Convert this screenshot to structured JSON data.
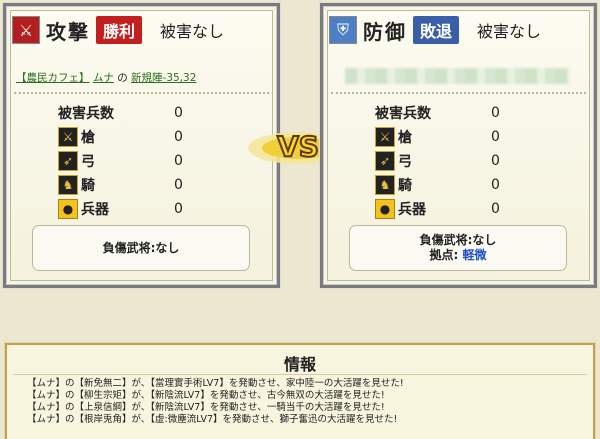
{
  "attacker": {
    "role": "攻撃",
    "result": "勝利",
    "damage": "被害なし",
    "location": {
      "alliance": "【農民カフェ】",
      "player": "ムナ",
      "connector": "の",
      "place": "新規陣-35,32"
    },
    "rows": [
      {
        "label": "被害兵数",
        "value": "0"
      },
      {
        "label": "槍",
        "value": "0",
        "icon": "spear-icon"
      },
      {
        "label": "弓",
        "value": "0",
        "icon": "bow-icon"
      },
      {
        "label": "騎",
        "value": "0",
        "icon": "horse-icon"
      },
      {
        "label": "兵器",
        "value": "0",
        "icon": "siege-weapon-icon"
      }
    ],
    "injured": "負傷武将:なし"
  },
  "defender": {
    "role": "防御",
    "result": "敗退",
    "damage": "被害なし",
    "rows": [
      {
        "label": "被害兵数",
        "value": "0"
      },
      {
        "label": "槍",
        "value": "0",
        "icon": "spear-icon"
      },
      {
        "label": "弓",
        "value": "0",
        "icon": "bow-icon"
      },
      {
        "label": "騎",
        "value": "0",
        "icon": "horse-icon"
      },
      {
        "label": "兵器",
        "value": "0",
        "icon": "siege-weapon-icon"
      }
    ],
    "injured": "負傷武将:なし",
    "base_label": "拠点:",
    "base_value": "軽微"
  },
  "vs_label": "VS",
  "info": {
    "title": "情報",
    "lines": [
      "【ムナ】の【新免無二】が、【當理實手術LV7】を発動させ、家中陸一の大活躍を見せた!",
      "【ムナ】の【柳生宗矩】が、【新陰流LV7】を発動させ、古今無双の大活躍を見せた!",
      "【ムナ】の【上泉信綱】が、【新陰流LV7】を発動させ、一騎当千の大活躍を見せた!",
      "【ムナ】の【根岸兎角】が、【虚:微塵流LV7】を発動させ、獅子奮迅の大活躍を見せた!"
    ]
  },
  "colors": {
    "win": "#c21f1f",
    "lose": "#3a5ea8",
    "accent": "#f3c21f"
  }
}
